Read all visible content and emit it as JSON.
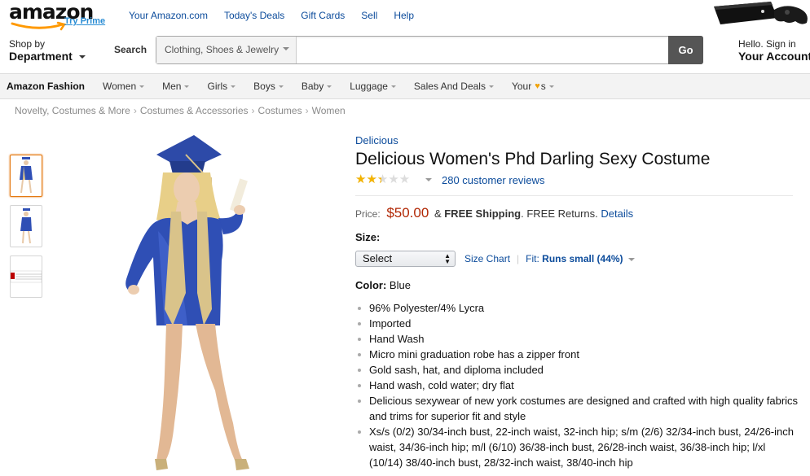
{
  "header": {
    "logo_text": "amazon",
    "try_prime": "Try Prime",
    "top_links": [
      "Your Amazon.com",
      "Today's Deals",
      "Gift Cards",
      "Sell",
      "Help"
    ]
  },
  "search_bar": {
    "shop_by_small": "Shop by",
    "shop_by_big": "Department",
    "search_label": "Search",
    "department_value": "Clothing, Shoes & Jewelry",
    "query": "",
    "go_label": "Go",
    "signin_small": "Hello. Sign in",
    "signin_big": "Your Account"
  },
  "category_nav": {
    "brand": "Amazon Fashion",
    "items": [
      "Women",
      "Men",
      "Girls",
      "Boys",
      "Baby",
      "Luggage",
      "Sales And Deals",
      "Your"
    ],
    "your_suffix": "s"
  },
  "breadcrumb": [
    "Novelty, Costumes & More",
    "Costumes & Accessories",
    "Costumes",
    "Women"
  ],
  "product": {
    "brand": "Delicious",
    "title": "Delicious Women's Phd Darling Sexy Costume",
    "rating_fraction": 0.4,
    "reviews": "280 customer reviews",
    "price_label": "Price:",
    "price": "$50.00",
    "price_amp": "&",
    "shipping": "FREE Shipping",
    "returns": ". FREE Returns.",
    "details_link": "Details",
    "size_label": "Size:",
    "size_value": "Select",
    "size_chart": "Size Chart",
    "fit_label": "Fit:",
    "fit_value": "Runs small (44%)",
    "color_label": "Color:",
    "color_value": "Blue",
    "bullets": [
      "96% Polyester/4% Lycra",
      "Imported",
      "Hand Wash",
      "Micro mini graduation robe has a zipper front",
      "Gold sash, hat, and diploma included",
      "Hand wash, cold water; dry flat",
      "Delicious sexywear of new york costumes are designed and crafted with high quality fabrics and trims for superior fit and style",
      "Xs/s (0/2) 30/34-inch bust, 22-inch waist, 32-inch hip; s/m (2/6) 32/34-inch bust, 24/26-inch waist, 34/36-inch hip; m/l (6/10) 36/38-inch bust, 26/28-inch waist, 36/38-inch hip; l/xl (10/14) 38/40-inch bust, 28/32-inch waist, 38/40-inch hip"
    ]
  },
  "colors": {
    "link": "#0b4b9b",
    "price": "#b12704",
    "star": "#f4b300",
    "robe": "#2f4fb5",
    "sash": "#d9c38a"
  }
}
